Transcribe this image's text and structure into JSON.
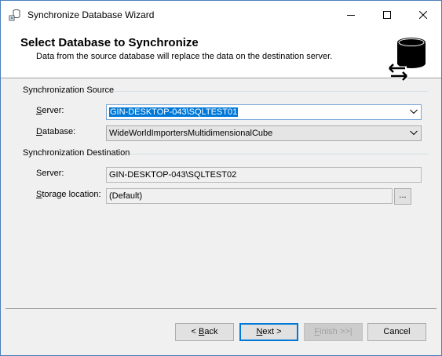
{
  "window": {
    "title": "Synchronize Database Wizard",
    "controls": [
      "minimize-icon",
      "maximize-icon",
      "close-icon"
    ]
  },
  "header": {
    "title": "Select Database to Synchronize",
    "description": "Data from the source database will replace the data on the destination server.",
    "icon": "database-sync-icon"
  },
  "source": {
    "section_label": "Synchronization Source",
    "server_label_pre": "",
    "server_label_key": "S",
    "server_label_post": "erver:",
    "server_value": "GIN-DESKTOP-043\\SQLTEST01",
    "database_label_pre": "",
    "database_label_key": "D",
    "database_label_post": "atabase:",
    "database_value": "WideWorldImportersMultidimensionalCube"
  },
  "destination": {
    "section_label": "Synchronization Destination",
    "server_label": "Server:",
    "server_value": "GIN-DESKTOP-043\\SQLTEST02",
    "storage_label_pre": "",
    "storage_label_key": "S",
    "storage_label_post": "torage location:",
    "storage_value": "(Default)",
    "browse_label": "..."
  },
  "buttons": {
    "back_pre": "< ",
    "back_key": "B",
    "back_post": "ack",
    "next_key": "N",
    "next_post": "ext >",
    "finish_key": "F",
    "finish_post": "inish >>|",
    "cancel": "Cancel"
  }
}
